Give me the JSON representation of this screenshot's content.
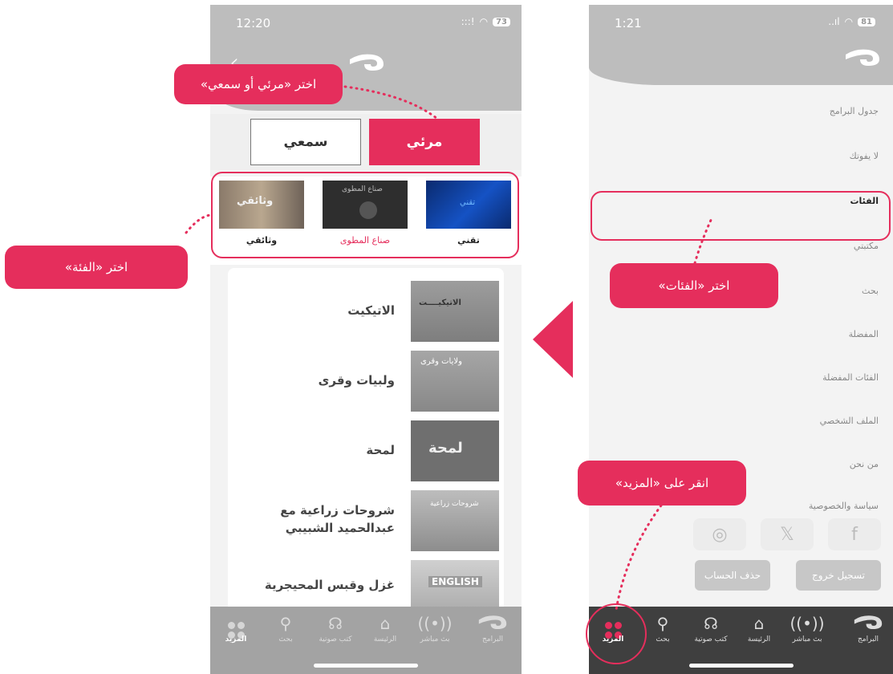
{
  "callouts": {
    "choose_type": "اختر «مرئي أو سمعي»",
    "choose_category": "اختر «الفئة»",
    "choose_categories": "اختر «الفئات»",
    "tap_more": "انقر على «المزيد»"
  },
  "left_phone": {
    "status": {
      "time": "12:20",
      "signal": ":::!",
      "wifi": "wifi",
      "battery": "73"
    },
    "toggle": {
      "video": "مرئي",
      "audio": "سمعي"
    },
    "categories": [
      {
        "label": "تقني",
        "thumb_text": "تقني"
      },
      {
        "label": "صناع المطوى",
        "thumb_text": "صناع المطوى"
      },
      {
        "label": "وثائقي",
        "thumb_text": "وثائقي"
      }
    ],
    "programs": [
      {
        "title": "الاتيكيت",
        "thumb_text": "الاتيكيــــت"
      },
      {
        "title": "ولبيات وقرى",
        "thumb_text": "ولايات وقرى"
      },
      {
        "title": "لمحة",
        "thumb_text": "لمحة"
      },
      {
        "title": "شروحات زراعية مع عبدالحميد الشبيبي",
        "thumb_text": "شروحات زراعية"
      },
      {
        "title": "غزل وقبس المحيجرية",
        "thumb_text": "ENGLISH"
      }
    ]
  },
  "right_phone": {
    "status": {
      "time": "1:21",
      "signal": "..ıl",
      "wifi": "wifi",
      "battery": "81"
    },
    "menu": [
      "جدول البرامج",
      "لا يفوتك",
      "الفئات",
      "مكتبتي",
      "بحث",
      "المفضلة",
      "الفئات المفضلة",
      "الملف الشخصي",
      "من نحن",
      "سياسة والخصوصية"
    ],
    "social": {
      "instagram": "◎",
      "x": "𝕏",
      "facebook": "f"
    },
    "buttons": {
      "logout": "تسجيل خروج",
      "delete": "حذف الحساب"
    }
  },
  "tabbar": {
    "more": "المزيد",
    "search": "بحث",
    "audiobooks": "كتب صوتية",
    "home": "الرئيسة",
    "live": "بث مباشر",
    "programs": "البرامج"
  },
  "colors": {
    "accent": "#e52e5c",
    "header_gray": "#bdbdbd",
    "tabbar_dark": "#3f3f3f"
  }
}
